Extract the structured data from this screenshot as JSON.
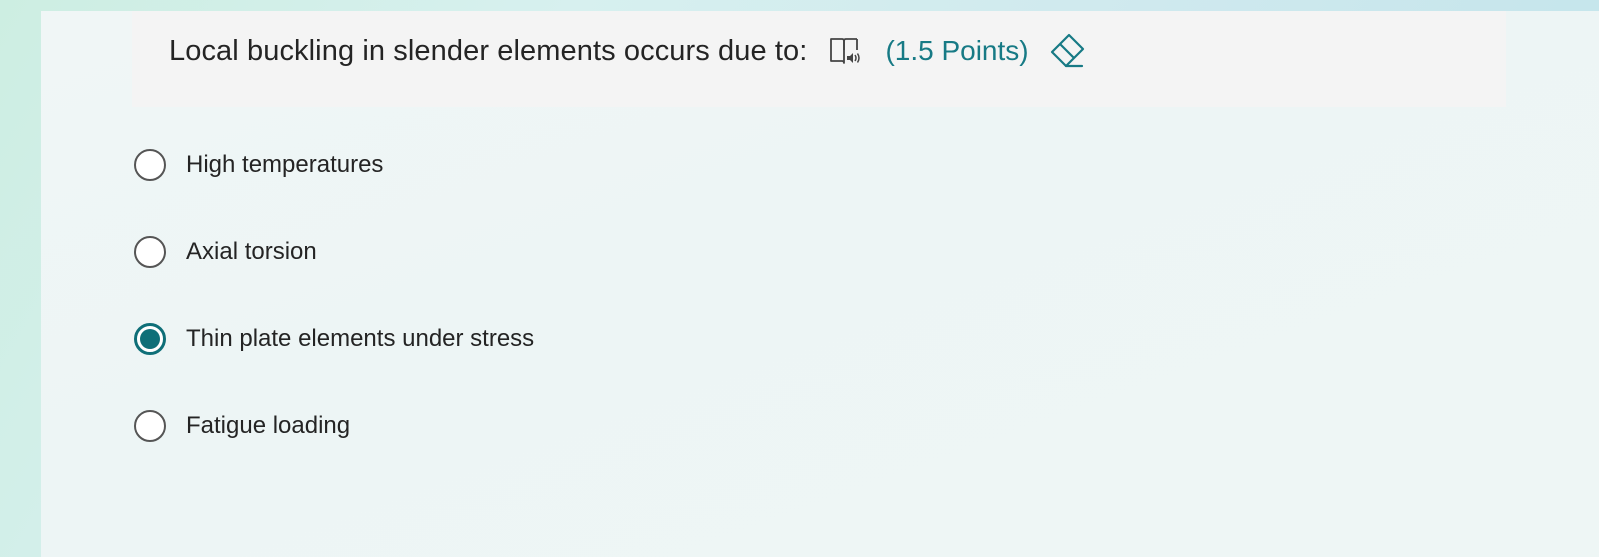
{
  "question": {
    "title": "Local buckling in slender elements occurs due to:",
    "points": "(1.5 Points)",
    "reader_icon": "immersive-reader-icon",
    "eraser_icon": "eraser-icon"
  },
  "options": [
    {
      "label": "High temperatures",
      "selected": false
    },
    {
      "label": "Axial torsion",
      "selected": false
    },
    {
      "label": "Thin plate elements under stress",
      "selected": true
    },
    {
      "label": "Fatigue loading",
      "selected": false
    }
  ],
  "colors": {
    "accent": "#177a85",
    "selected_radio": "#0f6f78"
  }
}
